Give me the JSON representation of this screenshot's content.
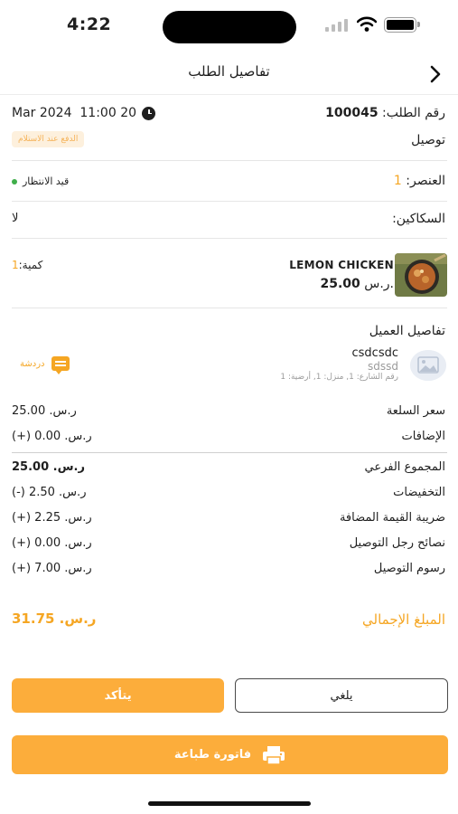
{
  "status_bar": {
    "time": "4:22"
  },
  "nav": {
    "title": "تفاصيل الطلب"
  },
  "order": {
    "date_time": "Mar 2024  11:00 20",
    "number_label": "رقم الطلب:",
    "number": "100045",
    "payment_badge": "الدفع عند الاستلام",
    "delivery_type": "توصيل",
    "status": "قيد الانتظار",
    "items_label": "العنصر:",
    "items_count": "1",
    "cutlery_label": "السكاكين:",
    "cutlery_value": "لا"
  },
  "product": {
    "name": "LEMON CHICKEN",
    "price_currency": "ر.س.",
    "price_value": "25.00",
    "qty_label": "كمية:",
    "qty_value": "1"
  },
  "customer": {
    "heading": "تفاصيل العميل",
    "name": "csdcsdc",
    "phone": "sdssd",
    "address": "رقم الشارع: 1, منزل: 1, أرضية: 1",
    "chat_label": "دردشة"
  },
  "prices": {
    "item_price_label": "سعر السلعة",
    "item_price_value": "ر.س. 25.00",
    "addons_label": "الإضافات",
    "addons_value": "(+)  ر.س. 0.00",
    "subtotal_label": "المجموع الفرعي",
    "subtotal_value": "ر.س. 25.00",
    "discount_label": "التخفيضات",
    "discount_value": "(-)  ر.س. 2.50",
    "vat_label": "ضريبة القيمة المضافة",
    "vat_value": "(+)  ر.س. 2.25",
    "tips_label": "نصائح رجل التوصيل",
    "tips_value": "(+)  ر.س. 0.00",
    "delivery_label": "رسوم التوصيل",
    "delivery_value": "(+)  ر.س. 7.00",
    "total_label": "المبلغ الإجمالي",
    "total_value": "ر.س. 31.75"
  },
  "actions": {
    "confirm": "يتأكد",
    "cancel": "يلغي",
    "print": "فاتورة طباعة"
  },
  "colors": {
    "accent": "#fcad3b",
    "status_dot": "#3fae4a"
  }
}
